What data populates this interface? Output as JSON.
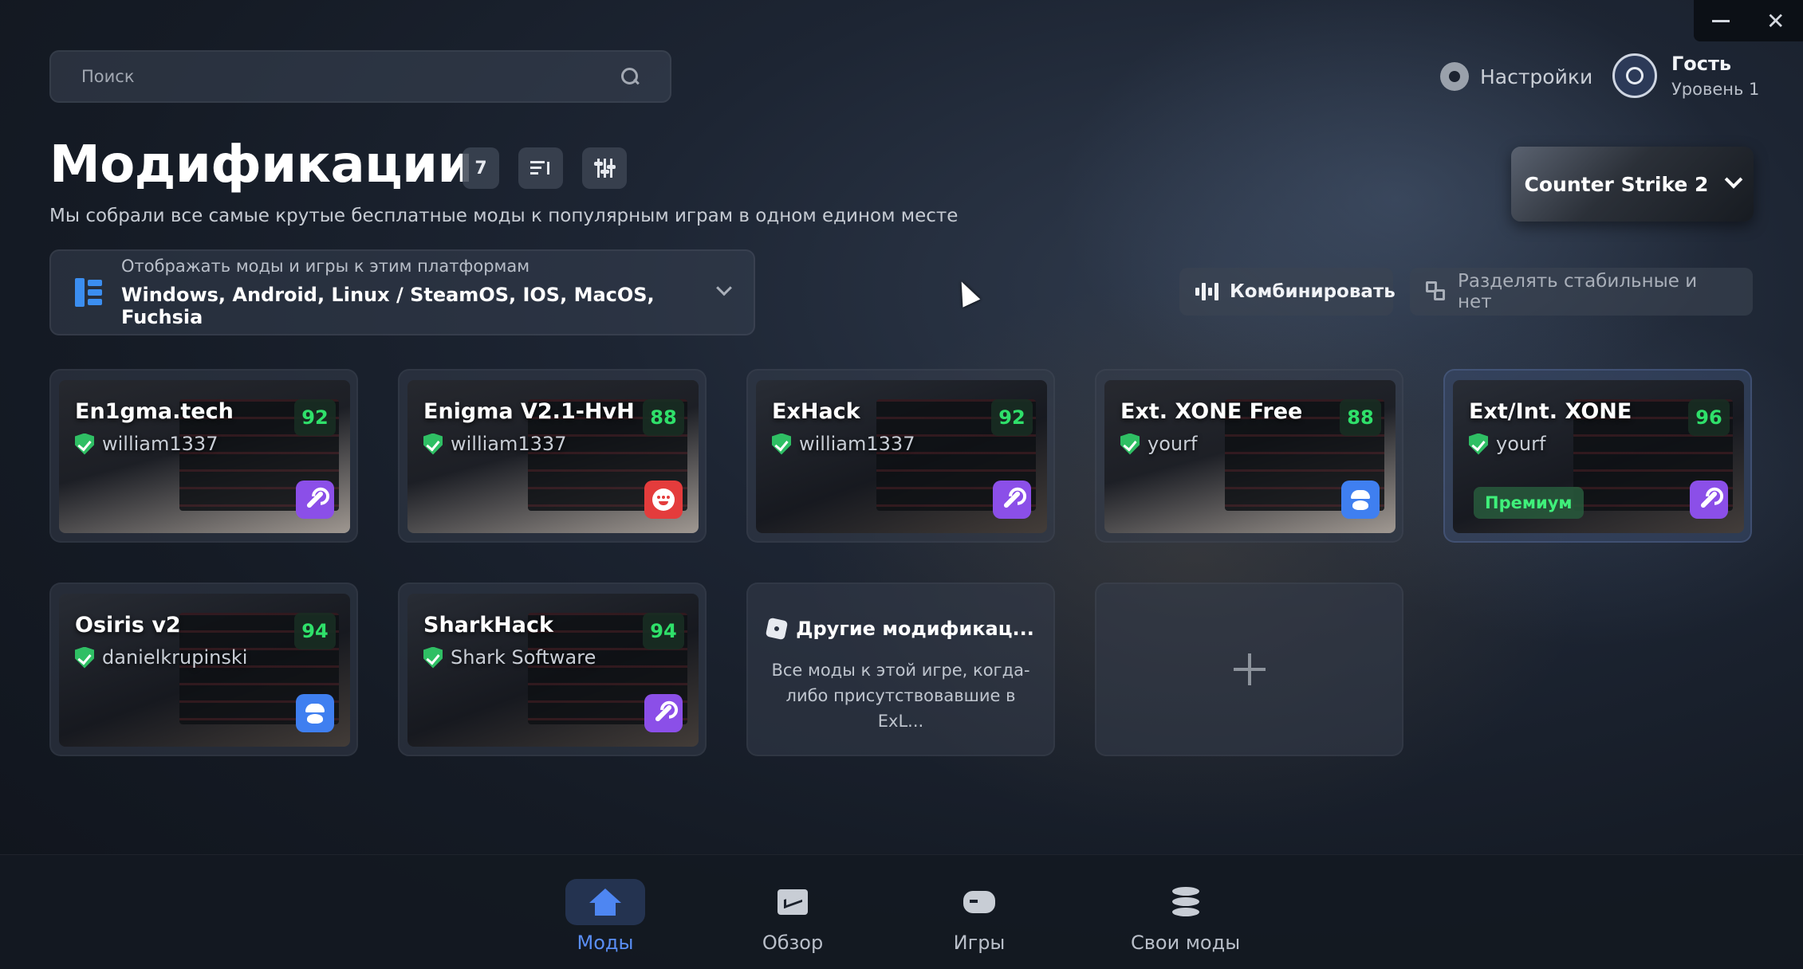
{
  "window": {
    "minimize_icon": "minimize-icon",
    "close_label": "✕"
  },
  "search": {
    "placeholder": "Поиск",
    "value": ""
  },
  "header": {
    "settings_label": "Настройки",
    "user": {
      "name": "Гость",
      "level": "Уровень 1"
    }
  },
  "title": {
    "text": "Модификации",
    "count": "7",
    "subtitle": "Мы собрали все самые крутые бесплатные моды к популярным играм в одном едином месте"
  },
  "game_select": {
    "value": "Counter Strike 2"
  },
  "platforms": {
    "label": "Отображать моды и игры к этим платформам",
    "value": "Windows, Android, Linux / SteamOS, IOS, MacOS, Fuchsia"
  },
  "actions": {
    "combine_label": "Комбинировать",
    "split_label": "Разделять стабильные и нет"
  },
  "mods": [
    {
      "name": "En1gma.tech",
      "author": "william1337",
      "score": "92",
      "type": "wrench-icon",
      "badge_color": "#8b4fe8"
    },
    {
      "name": "Enigma V2.1-HvH",
      "author": "william1337",
      "score": "88",
      "type": "face-icon",
      "badge_color": "#e43c3c"
    },
    {
      "name": "ExHack",
      "author": "william1337",
      "score": "92",
      "type": "wrench-icon",
      "badge_color": "#8b4fe8"
    },
    {
      "name": "Ext. XONE Free",
      "author": "yourf",
      "score": "88",
      "type": "spy-icon",
      "badge_color": "#3f7ff0"
    },
    {
      "name": "Ext/Int. XONE",
      "author": "yourf",
      "score": "96",
      "type": "wrench-icon",
      "badge_color": "#8b4fe8",
      "premium_label": "Премиум"
    },
    {
      "name": "Osiris v2",
      "author": "danielkrupinski",
      "score": "94",
      "type": "spy-icon",
      "badge_color": "#3f7ff0"
    },
    {
      "name": "SharkHack",
      "author": "Shark Software",
      "score": "94",
      "type": "wrench-icon",
      "badge_color": "#8b4fe8"
    }
  ],
  "other_mods": {
    "title": "Другие модификац...",
    "description": "Все моды к этой игре, когда-либо присутствовавшие в ExL..."
  },
  "nav": [
    {
      "label": "Моды",
      "icon": "home-icon",
      "active": true
    },
    {
      "label": "Обзор",
      "icon": "chart-board-icon",
      "active": false
    },
    {
      "label": "Игры",
      "icon": "gamepad-icon",
      "active": false
    },
    {
      "label": "Свои моды",
      "icon": "database-icon",
      "active": false
    }
  ],
  "colors": {
    "accent": "#4e86f2",
    "score_green": "#2fe06a",
    "verified": "#2fbf64"
  }
}
